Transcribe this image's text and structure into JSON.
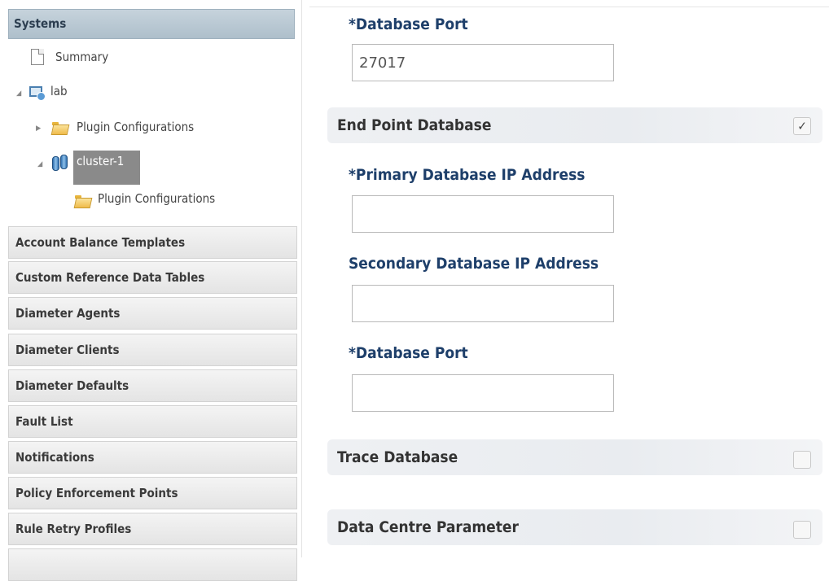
{
  "sidebar": {
    "header": "Systems",
    "tree": {
      "summary": "Summary",
      "lab": "lab",
      "lab_plugin": "Plugin Configurations",
      "cluster": "cluster-1",
      "cluster_plugin": "Plugin Configurations"
    },
    "items": [
      {
        "label": "Account Balance Templates"
      },
      {
        "label": "Custom Reference Data Tables"
      },
      {
        "label": "Diameter Agents"
      },
      {
        "label": "Diameter Clients"
      },
      {
        "label": "Diameter Defaults"
      },
      {
        "label": "Fault List"
      },
      {
        "label": "Notifications"
      },
      {
        "label": "Policy Enforcement Points"
      },
      {
        "label": "Rule Retry Profiles"
      }
    ]
  },
  "form": {
    "top_port_label": "*Database Port",
    "top_port_value": "27017",
    "end_point_db": {
      "title": "End Point Database",
      "checked": true,
      "check_mark": "✓",
      "primary_label": "*Primary Database IP Address",
      "primary_value": "",
      "secondary_label": "Secondary Database IP Address",
      "secondary_value": "",
      "port_label": "*Database Port",
      "port_value": ""
    },
    "trace_db": {
      "title": "Trace Database",
      "checked": false
    },
    "data_centre": {
      "title": "Data Centre Parameter",
      "checked": false
    }
  }
}
